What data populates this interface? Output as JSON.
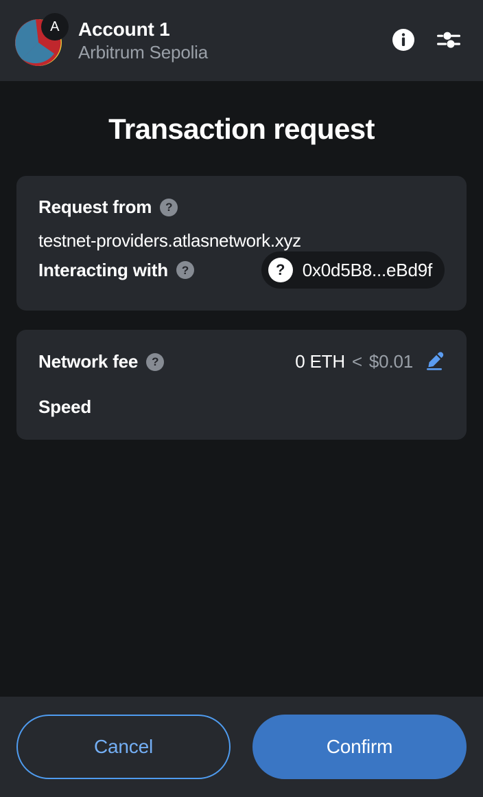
{
  "header": {
    "account_name": "Account 1",
    "network_name": "Arbitrum Sepolia",
    "avatar_badge_letter": "A",
    "info_icon": "info-icon",
    "settings_icon": "sliders-icon",
    "avatar_colors": [
      "#c0272d",
      "#3b7ea5",
      "#f2ca30"
    ]
  },
  "main": {
    "title": "Transaction request",
    "request_card": {
      "request_from_label": "Request from",
      "request_from_help": "?",
      "origin": "testnet-providers.atlasnetwork.xyz",
      "interacting_with_label": "Interacting with",
      "interacting_with_help": "?",
      "contract_avatar_glyph": "?",
      "contract_address": "0x0d5B8...eBd9f"
    },
    "fee_card": {
      "network_fee_label": "Network fee",
      "network_fee_help": "?",
      "fee_native": "0 ETH",
      "fee_separator": "<",
      "fee_fiat": "$0.01",
      "edit_icon": "pencil-edit-icon",
      "speed_label": "Speed",
      "speed_value": ""
    }
  },
  "footer": {
    "cancel_label": "Cancel",
    "confirm_label": "Confirm"
  },
  "colors": {
    "page_background": "#141618",
    "card_background": "#26292e",
    "accent_blue": "#3a76c4",
    "link_blue": "#74aff5",
    "muted_text": "#9aa0a8",
    "help_badge": "#868b93"
  }
}
